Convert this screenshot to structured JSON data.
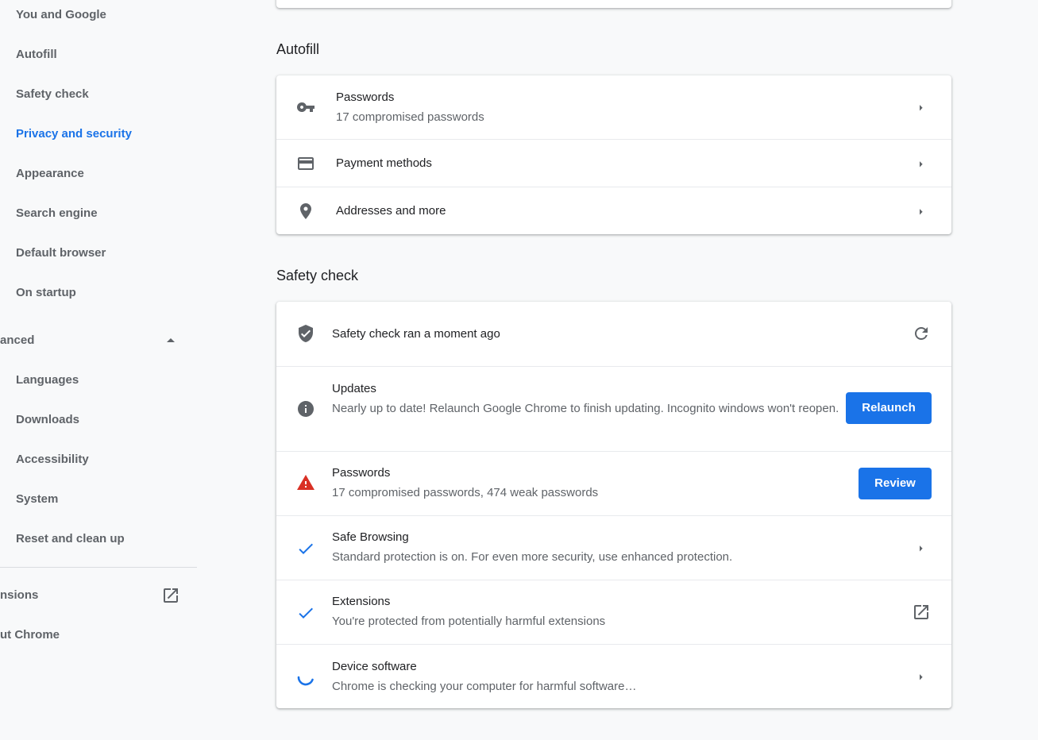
{
  "sidebar": {
    "items": [
      {
        "label": "You and Google"
      },
      {
        "label": "Autofill"
      },
      {
        "label": "Safety check"
      },
      {
        "label": "Privacy and security"
      },
      {
        "label": "Appearance"
      },
      {
        "label": "Search engine"
      },
      {
        "label": "Default browser"
      },
      {
        "label": "On startup"
      }
    ],
    "advanced_label": "anced",
    "advanced_items": [
      {
        "label": "Languages"
      },
      {
        "label": "Downloads"
      },
      {
        "label": "Accessibility"
      },
      {
        "label": "System"
      },
      {
        "label": "Reset and clean up"
      }
    ],
    "extensions_label": "nsions",
    "about_label": "ut Chrome",
    "active_item": "Privacy and security"
  },
  "autofill": {
    "title": "Autofill",
    "rows": [
      {
        "title": "Passwords",
        "subtitle": "17 compromised passwords",
        "icon": "key-icon"
      },
      {
        "title": "Payment methods",
        "icon": "credit-card-icon"
      },
      {
        "title": "Addresses and more",
        "icon": "location-pin-icon"
      }
    ]
  },
  "safety_check": {
    "title": "Safety check",
    "header": {
      "text": "Safety check ran a moment ago",
      "icon": "shield-check-icon",
      "action_icon": "refresh-icon"
    },
    "updates": {
      "title": "Updates",
      "subtitle": "Nearly up to date! Relaunch Google Chrome to finish updating. Incognito windows won't reopen.",
      "button": "Relaunch",
      "icon": "info-icon"
    },
    "passwords": {
      "title": "Passwords",
      "subtitle": "17 compromised passwords, 474 weak passwords",
      "button": "Review",
      "icon": "warning-icon"
    },
    "safe_browsing": {
      "title": "Safe Browsing",
      "subtitle": "Standard protection is on. For even more security, use enhanced protection.",
      "icon": "checkmark-icon"
    },
    "extensions": {
      "title": "Extensions",
      "subtitle": "You're protected from potentially harmful extensions",
      "icon": "checkmark-icon",
      "action_icon": "open-in-new-icon"
    },
    "device_software": {
      "title": "Device software",
      "subtitle": "Chrome is checking your computer for harmful software…",
      "icon": "spinner-icon"
    }
  },
  "colors": {
    "accent": "#1a73e8",
    "warning": "#d93025",
    "background": "#f8f9fa"
  }
}
